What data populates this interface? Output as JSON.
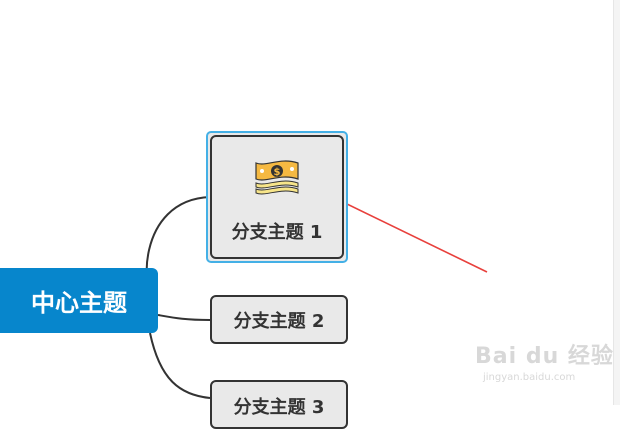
{
  "mindmap": {
    "central_topic": "中心主题",
    "branches": [
      {
        "label": "分支主题 1",
        "icon": "money-banknote-icon",
        "selected": true
      },
      {
        "label": "分支主题 2"
      },
      {
        "label": "分支主题 3"
      }
    ]
  },
  "watermark": {
    "brand": "Bai du 经验",
    "url": "jingyan.baidu.com"
  },
  "colors": {
    "central_bg": "#0786cc",
    "topic_bg": "#e9e9e9",
    "topic_border": "#333333",
    "selection": "#44b0e6",
    "arrow": "#e8403c",
    "money_icon": "#f5b942"
  }
}
